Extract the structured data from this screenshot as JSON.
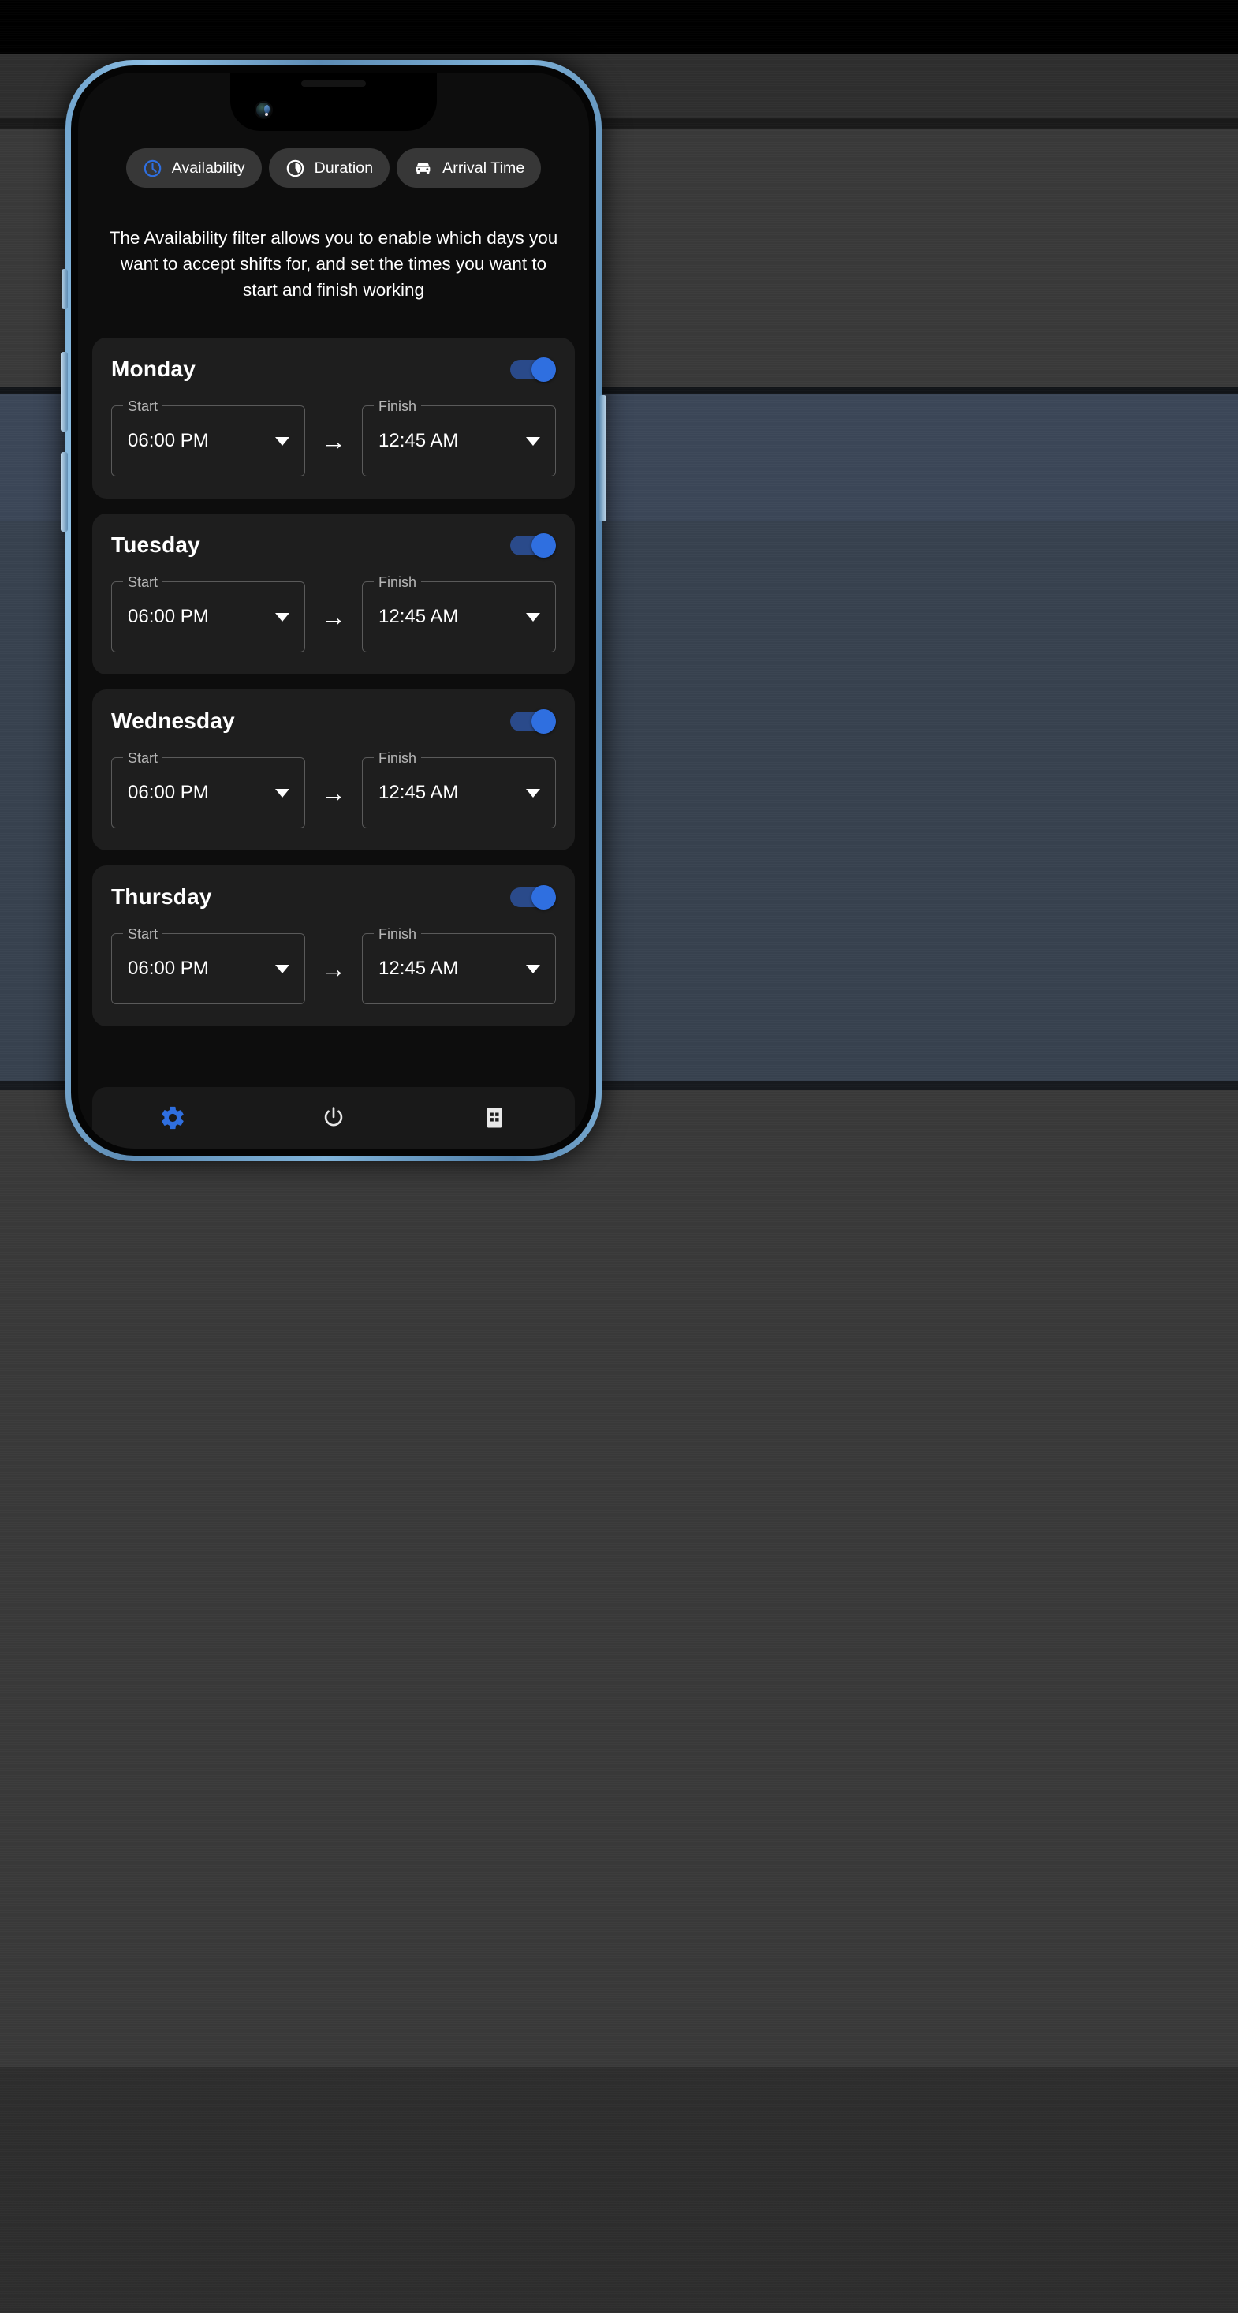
{
  "filters": {
    "chips": [
      {
        "label": "Availability",
        "icon": "clock-icon",
        "active": true,
        "icon_color": "#2f6fe0"
      },
      {
        "label": "Duration",
        "icon": "pie-timer-icon",
        "active": false,
        "icon_color": "#ffffff"
      },
      {
        "label": "Arrival Time",
        "icon": "car-icon",
        "active": false,
        "icon_color": "#ffffff"
      }
    ]
  },
  "description": "The Availability filter allows you to enable which days you want to accept shifts for, and set the times you want to start and finish working",
  "labels": {
    "start": "Start",
    "finish": "Finish",
    "arrow": "→"
  },
  "days": [
    {
      "name": "Monday",
      "enabled": true,
      "start": "06:00 PM",
      "finish": "12:45 AM"
    },
    {
      "name": "Tuesday",
      "enabled": true,
      "start": "06:00 PM",
      "finish": "12:45 AM"
    },
    {
      "name": "Wednesday",
      "enabled": true,
      "start": "06:00 PM",
      "finish": "12:45 AM"
    },
    {
      "name": "Thursday",
      "enabled": true,
      "start": "06:00 PM",
      "finish": "12:45 AM"
    }
  ],
  "navbar": {
    "items": [
      {
        "icon": "gear-icon",
        "active": true,
        "color": "#2f6fe0"
      },
      {
        "icon": "power-icon",
        "active": false,
        "color": "#e8e8e8"
      },
      {
        "icon": "apps-grid-icon",
        "active": false,
        "color": "#e8e8e8"
      }
    ]
  },
  "colors": {
    "accent": "#2f6fe0",
    "track": "#2a4a8a",
    "card_bg": "#1e1e1e",
    "screen_bg": "#0d0d0d",
    "chip_bg": "#373737",
    "frame": "#6ea2cc"
  }
}
